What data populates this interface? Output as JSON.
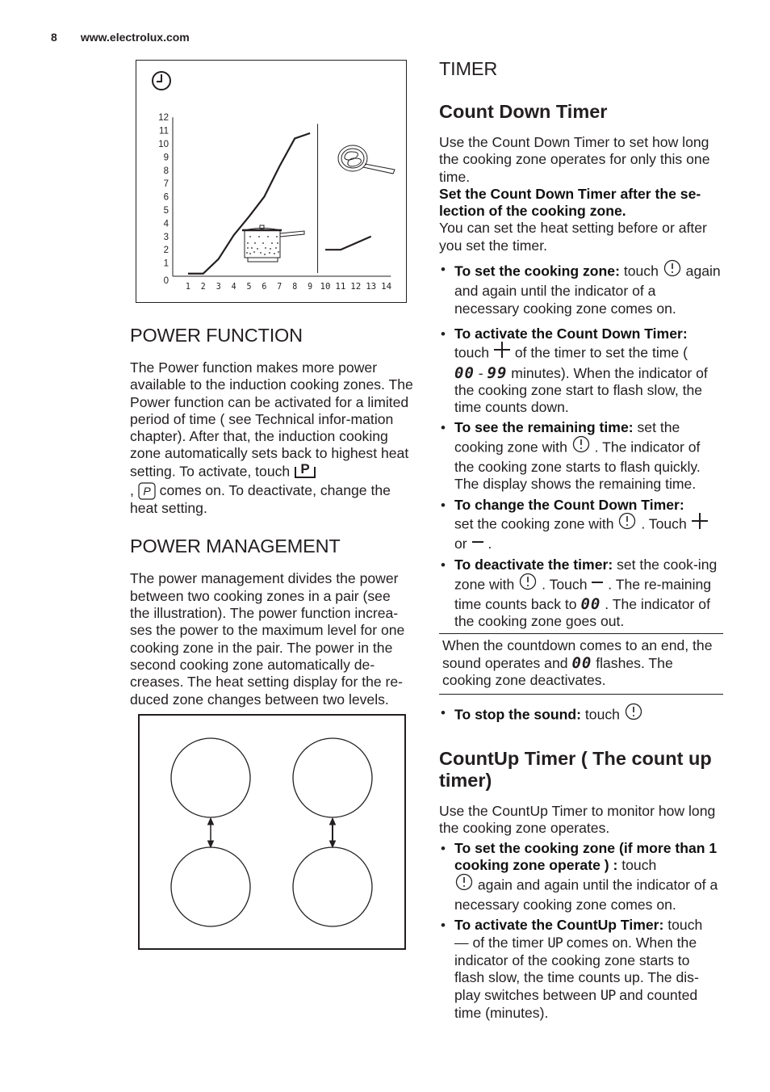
{
  "header": {
    "page_number": "8",
    "site": "www.electrolux.com"
  },
  "chart_data": {
    "type": "line",
    "title": "",
    "title_icon": "clock-icon",
    "xlabel": "",
    "ylabel": "",
    "x_ticks": [
      "1",
      "2",
      "3",
      "4",
      "5",
      "6",
      "7",
      "8",
      "9",
      "10",
      "11",
      "12",
      "13",
      "14"
    ],
    "y_ticks": [
      "0",
      "1",
      "2",
      "3",
      "4",
      "5",
      "6",
      "7",
      "8",
      "9",
      "10",
      "11",
      "12"
    ],
    "xlim": [
      0,
      14.3
    ],
    "ylim": [
      0,
      12
    ],
    "grid": false,
    "divider_x": 9.5,
    "series": [
      {
        "name": "pot-boiling",
        "icon": "saucepan-icon",
        "x": [
          1,
          2,
          3,
          4,
          5,
          6,
          7,
          8,
          9
        ],
        "y": [
          0.2,
          0.2,
          1.3,
          3.1,
          4.5,
          6.0,
          8.3,
          10.4,
          10.8
        ]
      },
      {
        "name": "frying-pan",
        "icon": "frying-pan-icon",
        "x": [
          10,
          11,
          12,
          13
        ],
        "y": [
          2.0,
          2.0,
          2.5,
          3.0
        ]
      }
    ]
  },
  "left": {
    "power_function": {
      "heading": "POWER FUNCTION",
      "text_before_icon": "The Power function makes more power available to the induction cooking zones. The Power function can be activated for a limited period of time ( see Technical infor-mation chapter). After that, the induction cooking zone automatically sets back to highest heat setting. To activate, touch",
      "text_comma": ",",
      "text_after_icon": "comes on. To deactivate, change the heat setting.",
      "touch_icon_label": "P",
      "display_icon_label": "P"
    },
    "power_management": {
      "heading": "POWER MANAGEMENT",
      "text": "The power management divides the power between two cooking zones in a pair (see the illustration). The power function increa-ses the power to the maximum level for one cooking zone in the pair. The power in the second cooking zone automatically de-creases. The heat setting display for the re-duced zone changes between two levels."
    }
  },
  "right": {
    "section_heading": "TIMER",
    "count_down": {
      "heading": "Count Down Timer",
      "intro": "Use the Count Down Timer to set how long the cooking zone operates for only this one time.",
      "bold_note": "Set the Count Down Timer after the se-lection of the cooking zone.",
      "after_note": "You can set the heat setting before or after you set the timer.",
      "items": [
        {
          "bold": "To set the cooking zone:",
          "t1": " touch ",
          "t2": " again and again until the indicator of a necessary cooking zone comes on."
        },
        {
          "bold": "To activate the Count Down Timer:",
          "t1": " touch ",
          "t2": " of the timer to set the time ( ",
          "seg1": "00",
          "dash": " - ",
          "seg2": "99",
          "t3": " minutes). When the indicator of the cooking zone start to flash slow, the time counts down."
        },
        {
          "bold": "To see the remaining time:",
          "t1": " set the cooking zone with ",
          "t2": " . The indicator of the cooking zone starts to flash quickly. The display shows the remaining time."
        },
        {
          "bold": "To change the Count Down Timer:",
          "t1": " set the cooking zone with ",
          "t2": " . Touch ",
          "t3": " or ",
          "t4": " ."
        },
        {
          "bold": "To deactivate the timer:",
          "t1": " set the cook-ing zone with ",
          "t2": " . Touch ",
          "t3": " . The re-maining time counts back to ",
          "seg1": "00",
          "t4": " . The indicator of the cooking zone goes out."
        }
      ],
      "note": {
        "t1": "When the countdown comes to an end, the sound operates and ",
        "seg1": "00",
        "t2": " flashes. The cooking zone deactivates."
      },
      "stop_sound": {
        "bold": "To stop the sound:",
        "t1": " touch "
      }
    },
    "count_up": {
      "heading": "CountUp Timer ( The count up timer)",
      "intro": "Use the CountUp Timer to monitor how long the cooking zone operates.",
      "items": [
        {
          "bold": "To set the cooking zone (if more than 1 cooking zone operate ) :",
          "t1": " touch ",
          "t2": " again and again until the indicator of a necessary cooking zone comes on."
        },
        {
          "bold": "To activate the CountUp Timer:",
          "t1": " touch ",
          "dash": "—",
          "t2": " of the timer ",
          "up1": "UP",
          "t3": " comes on. When the indicator of the cooking zone starts to flash slow, the time counts up. The dis-play switches between ",
          "up2": "UP",
          "t4": " and counted time (minutes)."
        }
      ]
    }
  },
  "bullet": "•"
}
